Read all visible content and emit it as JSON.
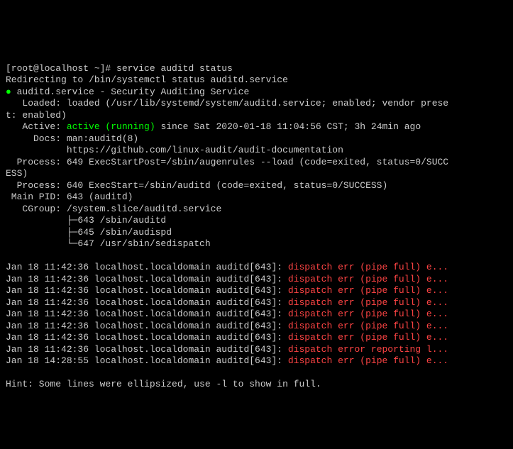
{
  "prompt": {
    "userhost": "[root@localhost ~]# ",
    "command": "service auditd status"
  },
  "redirect": "Redirecting to /bin/systemctl status auditd.service",
  "unit_header": {
    "bullet": "●",
    "name": " auditd.service - Security Auditing Service"
  },
  "loaded": "   Loaded: loaded (/usr/lib/systemd/system/auditd.service; enabled; vendor prese",
  "loaded2": "t: enabled)",
  "active": {
    "prefix": "   Active: ",
    "state": "active (running)",
    "since": " since Sat 2020-01-18 11:04:56 CST; 3h 24min ago"
  },
  "docs1": "     Docs: man:auditd(8)",
  "docs2": "           https://github.com/linux-audit/audit-documentation",
  "proc1": "  Process: 649 ExecStartPost=/sbin/augenrules --load (code=exited, status=0/SUCC",
  "proc1b": "ESS)",
  "proc2": "  Process: 640 ExecStart=/sbin/auditd (code=exited, status=0/SUCCESS)",
  "mainpid": " Main PID: 643 (auditd)",
  "cgroup": "   CGroup: /system.slice/auditd.service",
  "cg1": "           ├─643 /sbin/auditd",
  "cg2": "           ├─645 /sbin/audispd",
  "cg3": "           └─647 /usr/sbin/sedispatch",
  "blank": "",
  "logs": [
    {
      "pre": "Jan 18 11:42:36 localhost.localdomain auditd[643]: ",
      "msg": "dispatch err (pipe full) e..."
    },
    {
      "pre": "Jan 18 11:42:36 localhost.localdomain auditd[643]: ",
      "msg": "dispatch err (pipe full) e..."
    },
    {
      "pre": "Jan 18 11:42:36 localhost.localdomain auditd[643]: ",
      "msg": "dispatch err (pipe full) e..."
    },
    {
      "pre": "Jan 18 11:42:36 localhost.localdomain auditd[643]: ",
      "msg": "dispatch err (pipe full) e..."
    },
    {
      "pre": "Jan 18 11:42:36 localhost.localdomain auditd[643]: ",
      "msg": "dispatch err (pipe full) e..."
    },
    {
      "pre": "Jan 18 11:42:36 localhost.localdomain auditd[643]: ",
      "msg": "dispatch err (pipe full) e..."
    },
    {
      "pre": "Jan 18 11:42:36 localhost.localdomain auditd[643]: ",
      "msg": "dispatch err (pipe full) e..."
    },
    {
      "pre": "Jan 18 11:42:36 localhost.localdomain auditd[643]: ",
      "msg": "dispatch error reporting l..."
    },
    {
      "pre": "Jan 18 14:28:55 localhost.localdomain auditd[643]: ",
      "msg": "dispatch err (pipe full) e..."
    }
  ],
  "hint": "Hint: Some lines were ellipsized, use -l to show in full."
}
